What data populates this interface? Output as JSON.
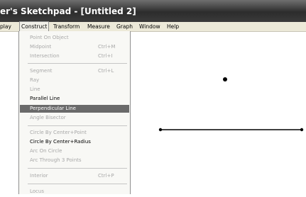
{
  "window": {
    "title": "er's Sketchpad - [Untitled 2]"
  },
  "menubar": {
    "items": [
      "play",
      "Construct",
      "Transform",
      "Measure",
      "Graph",
      "Window",
      "Help"
    ]
  },
  "construct_menu": {
    "items": [
      {
        "label": "Point On Object",
        "shortcut": "",
        "state": "disabled"
      },
      {
        "label": "Midpoint",
        "shortcut": "Ctrl+M",
        "state": "disabled"
      },
      {
        "label": "Intersection",
        "shortcut": "Ctrl+I",
        "state": "disabled"
      },
      {
        "label": "Segment",
        "shortcut": "Ctrl+L",
        "state": "disabled"
      },
      {
        "label": "Ray",
        "shortcut": "",
        "state": "disabled"
      },
      {
        "label": "Line",
        "shortcut": "",
        "state": "disabled"
      },
      {
        "label": "Parallel Line",
        "shortcut": "",
        "state": "enabled"
      },
      {
        "label": "Perpendicular Line",
        "shortcut": "",
        "state": "highlighted"
      },
      {
        "label": "Angle Bisector",
        "shortcut": "",
        "state": "disabled"
      },
      {
        "label": "Circle By Center+Point",
        "shortcut": "",
        "state": "disabled"
      },
      {
        "label": "Circle By Center+Radius",
        "shortcut": "",
        "state": "enabled"
      },
      {
        "label": "Arc On Circle",
        "shortcut": "",
        "state": "disabled"
      },
      {
        "label": "Arc Through 3 Points",
        "shortcut": "",
        "state": "disabled"
      },
      {
        "label": "Interior",
        "shortcut": "Ctrl+P",
        "state": "disabled"
      },
      {
        "label": "Locus",
        "shortcut": "",
        "state": "disabled"
      }
    ]
  },
  "colors": {
    "highlight": "#6a6a6a",
    "disabled_text": "#a8a8a8",
    "canvas_objects": "#000000"
  }
}
